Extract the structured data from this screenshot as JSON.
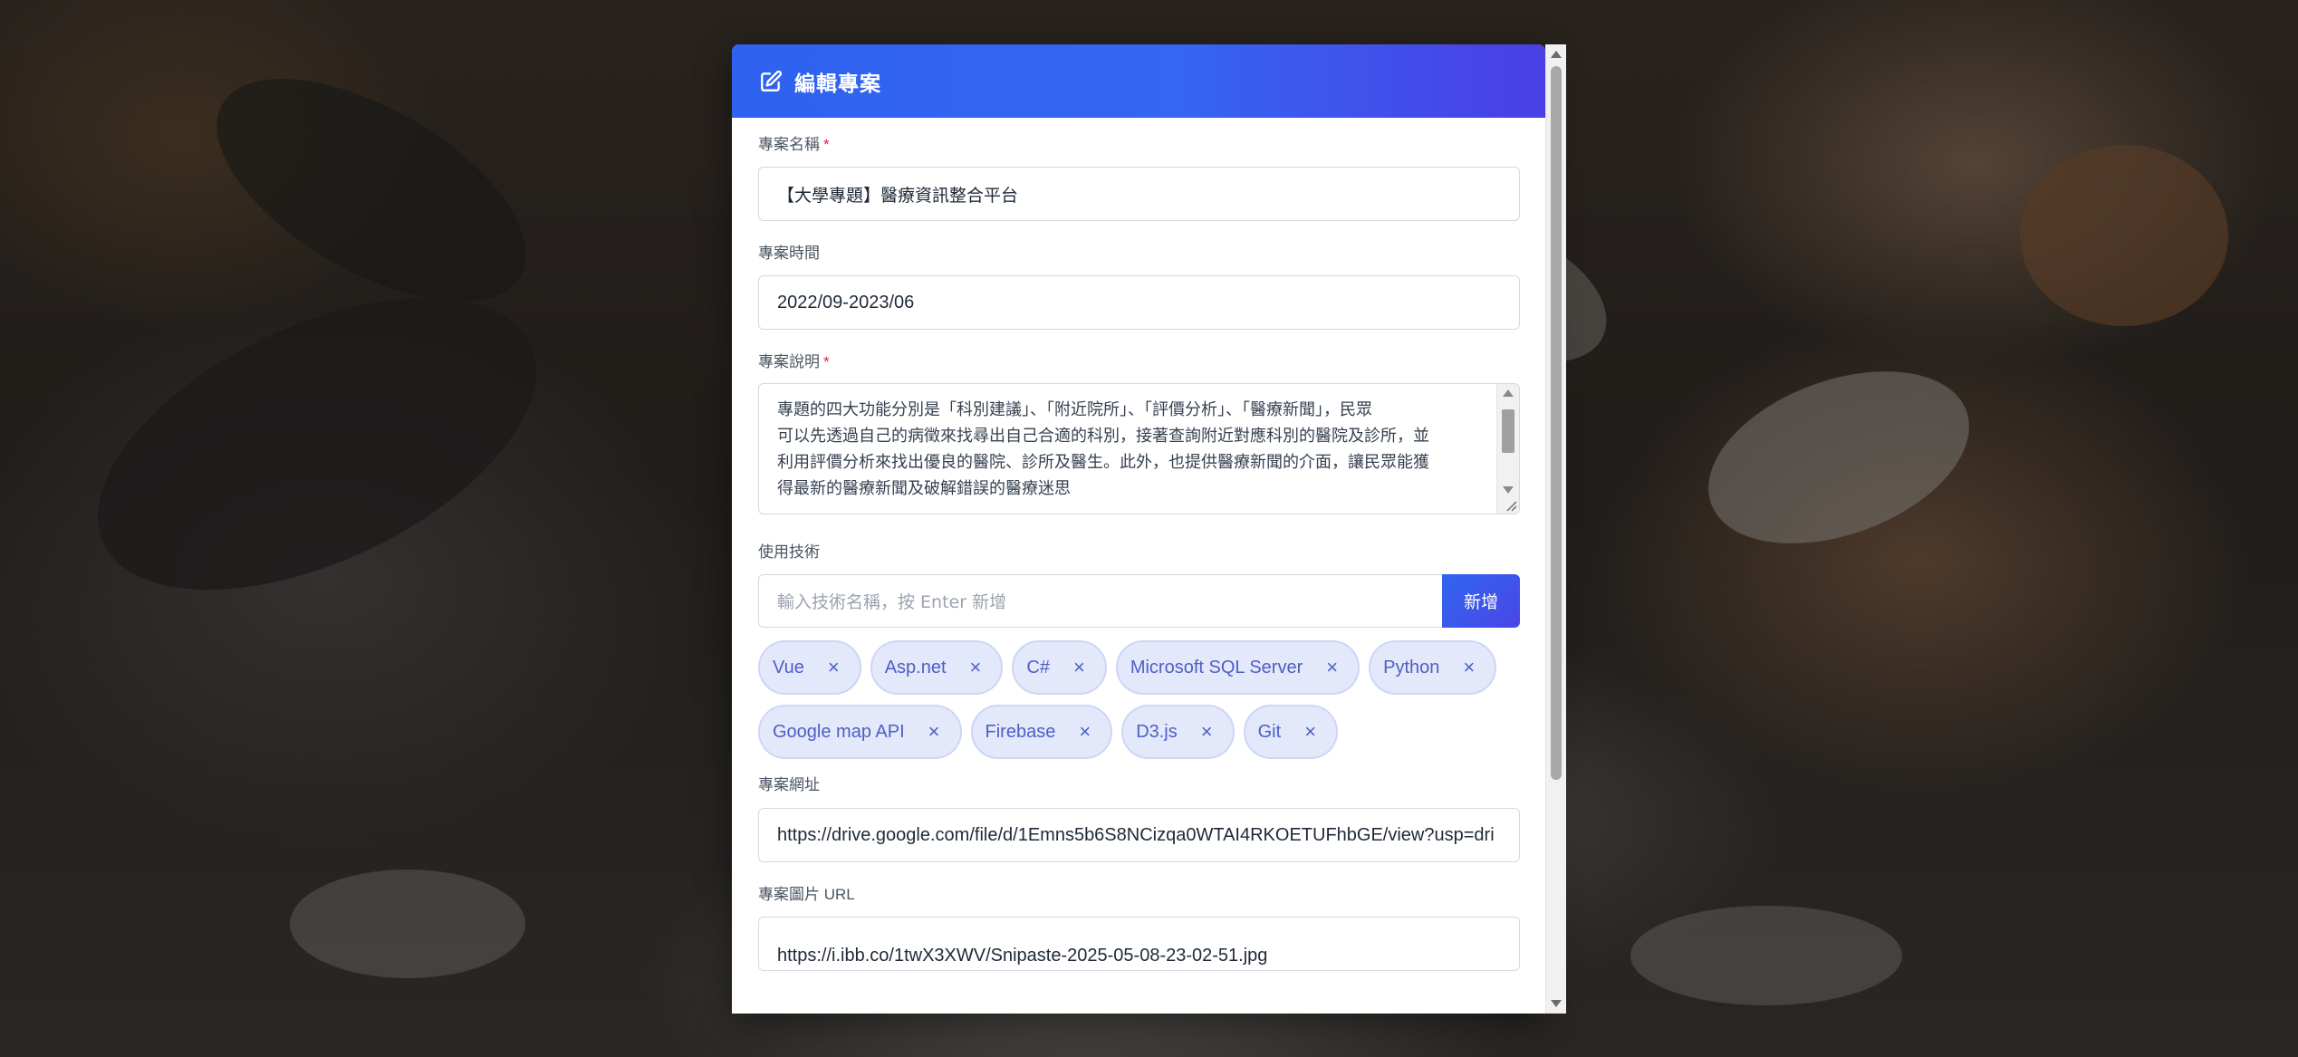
{
  "modal": {
    "title": "編輯專案",
    "icon": "edit-icon",
    "accent_color": "#3565f1"
  },
  "form": {
    "name": {
      "label": "專案名稱",
      "required_mark": "*",
      "value": "【大學專題】醫療資訊整合平台"
    },
    "period": {
      "label": "專案時間",
      "value": "2022/09-2023/06"
    },
    "description": {
      "label": "專案說明",
      "required_mark": "*",
      "lines": [
        "專題的四大功能分別是「科別建議」、「附近院所」、「評價分析」、「醫療新聞」，民眾",
        "可以先透過自己的病徵來找尋出自己合適的科別，接著查詢附近對應科別的醫院及診所，並",
        "利用評價分析來找出優良的醫院、診所及醫生。此外，也提供醫療新聞的介面，讓民眾能獲",
        "得最新的醫療新聞及破解錯誤的醫療迷思"
      ]
    },
    "tech": {
      "label": "使用技術",
      "placeholder": "輸入技術名稱，按 Enter 新增",
      "add_button": "新增",
      "remove_glyph": "×",
      "tags": [
        "Vue",
        "Asp.net",
        "C#",
        "Microsoft SQL Server",
        "Python",
        "Google map API",
        "Firebase",
        "D3.js",
        "Git"
      ]
    },
    "url": {
      "label": "專案網址",
      "value": "https://drive.google.com/file/d/1Emns5b6S8NCizqa0WTAI4RKOETUFhbGE/view?usp=dri"
    },
    "image_url": {
      "label": "專案圖片 URL",
      "value": "https://i.ibb.co/1twX3XWV/Snipaste-2025-05-08-23-02-51.jpg"
    }
  }
}
